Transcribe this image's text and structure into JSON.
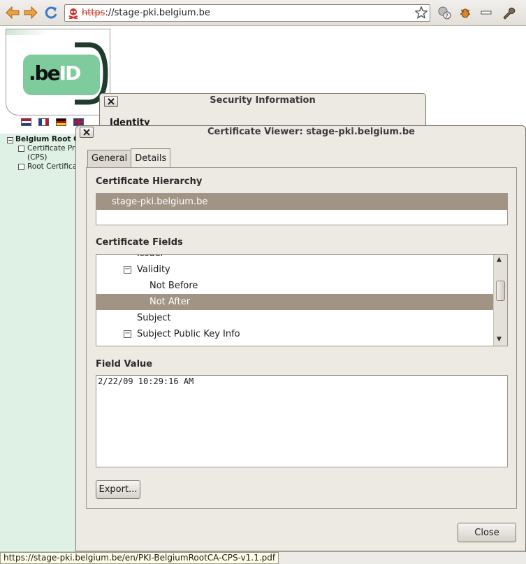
{
  "browser": {
    "url_protocol": "https",
    "url_rest": "://stage-pki.belgium.be",
    "status_url": "https://stage-pki.belgium.be/en/PKI-BelgiumRootCA-CPS-v1.1.pdf"
  },
  "webpage": {
    "logo_prefix": ".be",
    "logo_suffix": "ID",
    "tree_root": "Belgium Root C",
    "tree_items": [
      "Certificate Pra",
      "(CPS)",
      "Root Certifica"
    ]
  },
  "security_dialog": {
    "title": "Security Information",
    "heading": "Identity"
  },
  "cert_viewer": {
    "title": "Certificate Viewer: stage-pki.belgium.be",
    "tabs": [
      "General",
      "Details"
    ],
    "hierarchy_label": "Certificate Hierarchy",
    "hierarchy_items": [
      "stage-pki.belgium.be"
    ],
    "fields_label": "Certificate Fields",
    "fields": [
      "Issuer",
      "Validity",
      "Not Before",
      "Not After",
      "Subject",
      "Subject Public Key Info"
    ],
    "value_label": "Field Value",
    "field_value": "2/22/09 10:29:16 AM",
    "export_button": "Export...",
    "close_button": "Close"
  },
  "colors": {
    "selection": "#a29485",
    "logo_green": "#7ecb9b",
    "logo_dark": "#1e3d2c"
  }
}
